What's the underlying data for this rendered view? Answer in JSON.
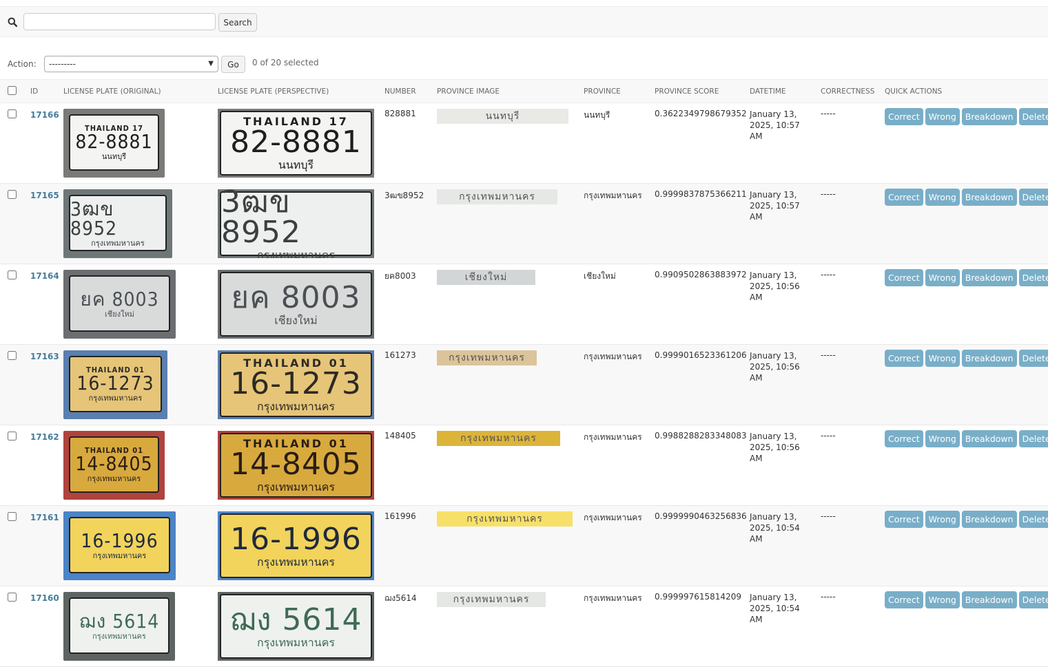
{
  "search": {
    "button_label": "Search",
    "value": ""
  },
  "actions": {
    "label": "Action:",
    "selected": "---------",
    "go_label": "Go",
    "selected_count": "0 of 20 selected"
  },
  "columns": [
    "ID",
    "LICENSE PLATE (ORIGINAL)",
    "LICENSE PLATE (PERSPECTIVE)",
    "NUMBER",
    "PROVINCE IMAGE",
    "PROVINCE",
    "PROVINCE SCORE",
    "DATETIME",
    "CORRECTNESS",
    "QUICK ACTIONS"
  ],
  "quick_actions": [
    "Correct",
    "Wrong",
    "Breakdown",
    "Delete"
  ],
  "rows": [
    {
      "id": "17166",
      "plate_top": "THAILAND 17",
      "plate_num": "82-8881",
      "plate_prov": "นนทบุรี",
      "number": "828881",
      "province_img": "นนทบุรี",
      "province": "นนทบุรี",
      "score": "0.3622349798679352",
      "datetime": [
        "January 13,",
        "2025, 10:57",
        "AM"
      ],
      "correctness": "-----",
      "plate_bg": "#f4f4f2",
      "frame_bg": "#7a7a78",
      "ink": "#1e1e1e",
      "prov_bg": "#e9e9e6"
    },
    {
      "id": "17165",
      "plate_top": "",
      "plate_num": "3ฒข 8952",
      "plate_prov": "กรุงเทพมหานคร",
      "number": "3ฒข8952",
      "province_img": "กรุงเทพมหานคร",
      "province": "กรุงเทพมหานคร",
      "score": "0.9999837875366211",
      "datetime": [
        "January 13,",
        "2025, 10:57",
        "AM"
      ],
      "correctness": "-----",
      "plate_bg": "#eef0ef",
      "frame_bg": "#6f7677",
      "ink": "#3a3f40",
      "prov_bg": "#e6e8e6"
    },
    {
      "id": "17164",
      "plate_top": "",
      "plate_num": "ยค 8003",
      "plate_prov": "เชียงใหม่",
      "number": "ยค8003",
      "province_img": "เชียงใหม่",
      "province": "เชียงใหม่",
      "score": "0.9909502863883972",
      "datetime": [
        "January 13,",
        "2025, 10:56",
        "AM"
      ],
      "correctness": "-----",
      "plate_bg": "#d9dbdb",
      "frame_bg": "#6b6e70",
      "ink": "#4b5054",
      "prov_bg": "#d3d6d6"
    },
    {
      "id": "17163",
      "plate_top": "THAILAND 01",
      "plate_num": "16-1273",
      "plate_prov": "กรุงเทพมหานคร",
      "number": "161273",
      "province_img": "กรุงเทพมหานคร",
      "province": "กรุงเทพมหานคร",
      "score": "0.9999016523361206",
      "datetime": [
        "January 13,",
        "2025, 10:56",
        "AM"
      ],
      "correctness": "-----",
      "plate_bg": "#e6c579",
      "frame_bg": "#5a7fb0",
      "ink": "#2d2a24",
      "prov_bg": "#dcc49a"
    },
    {
      "id": "17162",
      "plate_top": "THAILAND 01",
      "plate_num": "14-8405",
      "plate_prov": "กรุงเทพมหานคร",
      "number": "148405",
      "province_img": "กรุงเทพมหานคร",
      "province": "กรุงเทพมหานคร",
      "score": "0.9988288283348083",
      "datetime": [
        "January 13,",
        "2025, 10:56",
        "AM"
      ],
      "correctness": "-----",
      "plate_bg": "#d8a93d",
      "frame_bg": "#b0433e",
      "ink": "#2a1d14",
      "prov_bg": "#dcb43a"
    },
    {
      "id": "17161",
      "plate_top": "",
      "plate_num": "16-1996",
      "plate_prov": "กรุงเทพมหานคร",
      "number": "161996",
      "province_img": "กรุงเทพมหานคร",
      "province": "กรุงเทพมหานคร",
      "score": "0.9999990463256836",
      "datetime": [
        "January 13,",
        "2025, 10:54",
        "AM"
      ],
      "correctness": "-----",
      "plate_bg": "#f2d35c",
      "frame_bg": "#4b84c7",
      "ink": "#1f2a3b",
      "prov_bg": "#f7e06a"
    },
    {
      "id": "17160",
      "plate_top": "",
      "plate_num": "ฌง 5614",
      "plate_prov": "กรุงเทพมหานคร",
      "number": "ฌง5614",
      "province_img": "กรุงเทพมหานคร",
      "province": "กรุงเทพมหานคร",
      "score": "0.999997615814209",
      "datetime": [
        "January 13,",
        "2025, 10:54",
        "AM"
      ],
      "correctness": "-----",
      "plate_bg": "#eef1ee",
      "frame_bg": "#5e6463",
      "ink": "#3f6a55",
      "prov_bg": "#e4e7e4"
    }
  ]
}
